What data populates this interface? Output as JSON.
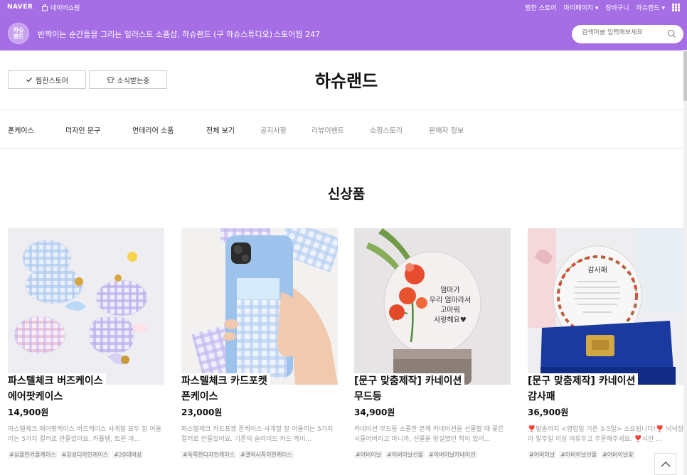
{
  "topbar": {
    "naver": "NAVER",
    "shopping": "네이버쇼핑",
    "right": [
      "찜한 스토어",
      "마이페이지",
      "장바구니",
      "하슈랜드"
    ]
  },
  "store": {
    "logo_text": "하슈랜드",
    "description": "반짝이는 순간들을 그리는 일러스트 소품샵, 하슈랜드 (구 하슈스튜디오)",
    "zzim_count": "스토어찜 247",
    "search_placeholder": "검색어를 입력해보세요"
  },
  "header": {
    "zzim_button": "찜한스토어",
    "subscribe_button": "소식받는중",
    "title": "하슈랜드"
  },
  "nav": [
    {
      "label": "폰케이스",
      "dropdown": true
    },
    {
      "label": "디자인 문구",
      "dropdown": true
    },
    {
      "label": "인테리어 소품",
      "dropdown": true
    },
    {
      "label": "전체 보기",
      "dropdown": false
    },
    {
      "label": "공지사항",
      "dropdown": false
    },
    {
      "label": "리뷰이벤트",
      "dropdown": false
    },
    {
      "label": "쇼핑스토리",
      "dropdown": false
    },
    {
      "label": "판매자 정보",
      "dropdown": false
    }
  ],
  "section_title": "신상품",
  "products": [
    {
      "name_line1": "파스텔체크 버즈케이스",
      "name_line2": "에어팟케이스",
      "price": "14,900원",
      "desc": "파스텔체크 에어팟케이스 버즈케이스 사계절 모두 잘 어울리는 5가지 컬러로 만들었어요. 커플템, 트윈 아...",
      "tags": [
        "#심플한커플케이스",
        "#감성디자인케이스",
        "#20대여성"
      ]
    },
    {
      "name_line1": "파스텔체크 카드포켓",
      "name_line2": "폰케이스",
      "price": "23,000원",
      "desc": "파스텔체크 카드포켓 폰케이스 사계절 잘 어울리는 5가지 컬러로 만들었어요. 기존의 슬라이드 카드 케이...",
      "tags": [
        "#독특한디자인케이스",
        "#갤럭시특이한케이스"
      ]
    },
    {
      "name_line1": "[문구 맞춤제작] 카네이션",
      "name_line2": "무드등",
      "price": "34,900원",
      "desc": "카네이션 무드등 소중한 분께 카네이션을 선물할 때 꽃은 시들어버리고 마니까, 선물을 망설였던 적이 있어...",
      "tags": [
        "#어버이날",
        "#어버이날선물",
        "#어버이날카네이션"
      ]
    },
    {
      "name_line1": "[문구 맞춤제작] 카네이션",
      "name_line2": "감사패",
      "price": "36,900원",
      "desc": "❣️발송까지 <영업일 기준 3-5일> 소요됩니다!❣️ 넉넉잡아 일주일 이상 여유두고 주문해주세요. ❣️시안 ...",
      "tags": [
        "#어버이날",
        "#어버이날선물",
        "#어버이날꽃"
      ]
    }
  ],
  "image_text": {
    "mood_lamp": [
      "엄마가",
      "우리 엄마라서",
      "고마워",
      "사랑해요♥"
    ],
    "plaque_title": "감사패"
  },
  "colors": {
    "brand": "#a56ee4"
  }
}
